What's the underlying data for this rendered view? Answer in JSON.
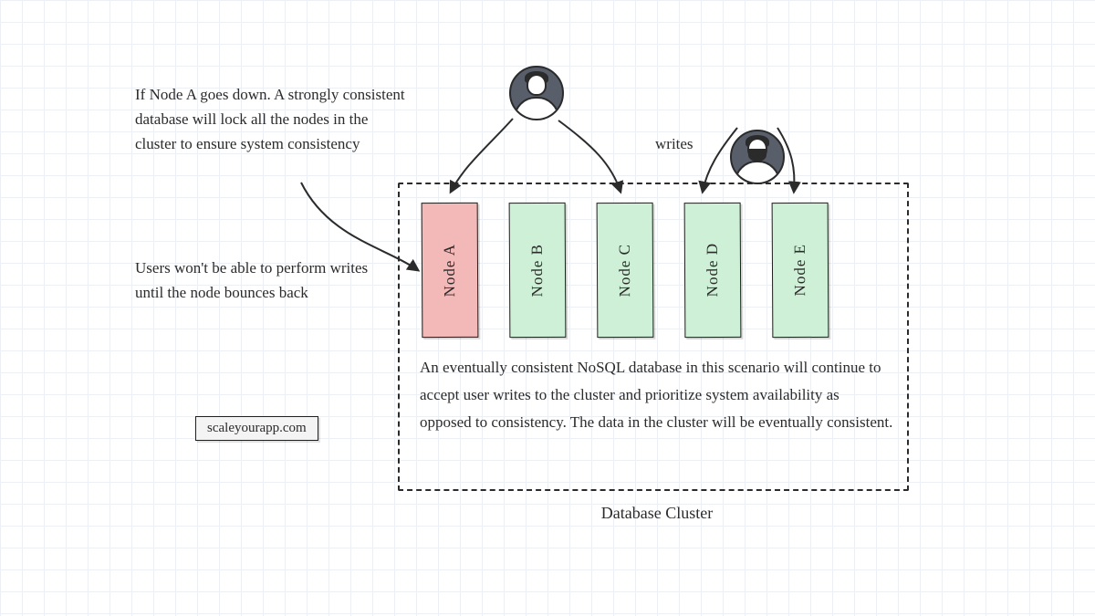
{
  "annotation_top": "If Node A goes down. A strongly consistent database will lock all the nodes in the cluster to ensure system consistency",
  "annotation_mid": "Users won't be able to perform writes until the node bounces back",
  "writes_label": "writes",
  "cluster": {
    "label": "Database Cluster",
    "nodes": [
      {
        "name": "Node A",
        "state": "down"
      },
      {
        "name": "Node B",
        "state": "up"
      },
      {
        "name": "Node C",
        "state": "up"
      },
      {
        "name": "Node D",
        "state": "up"
      },
      {
        "name": "Node E",
        "state": "up"
      }
    ],
    "explanation": "An eventually consistent NoSQL database in this scenario will continue to accept user writes to the cluster and prioritize system availability as opposed to consistency. The data in the cluster will be eventually consistent."
  },
  "attribution": "scaleyourapp.com",
  "colors": {
    "node_down_bg": "#f3b8b8",
    "node_up_bg": "#cef0d6",
    "grid_line": "#eceff3",
    "ink": "#2b2b2b"
  }
}
